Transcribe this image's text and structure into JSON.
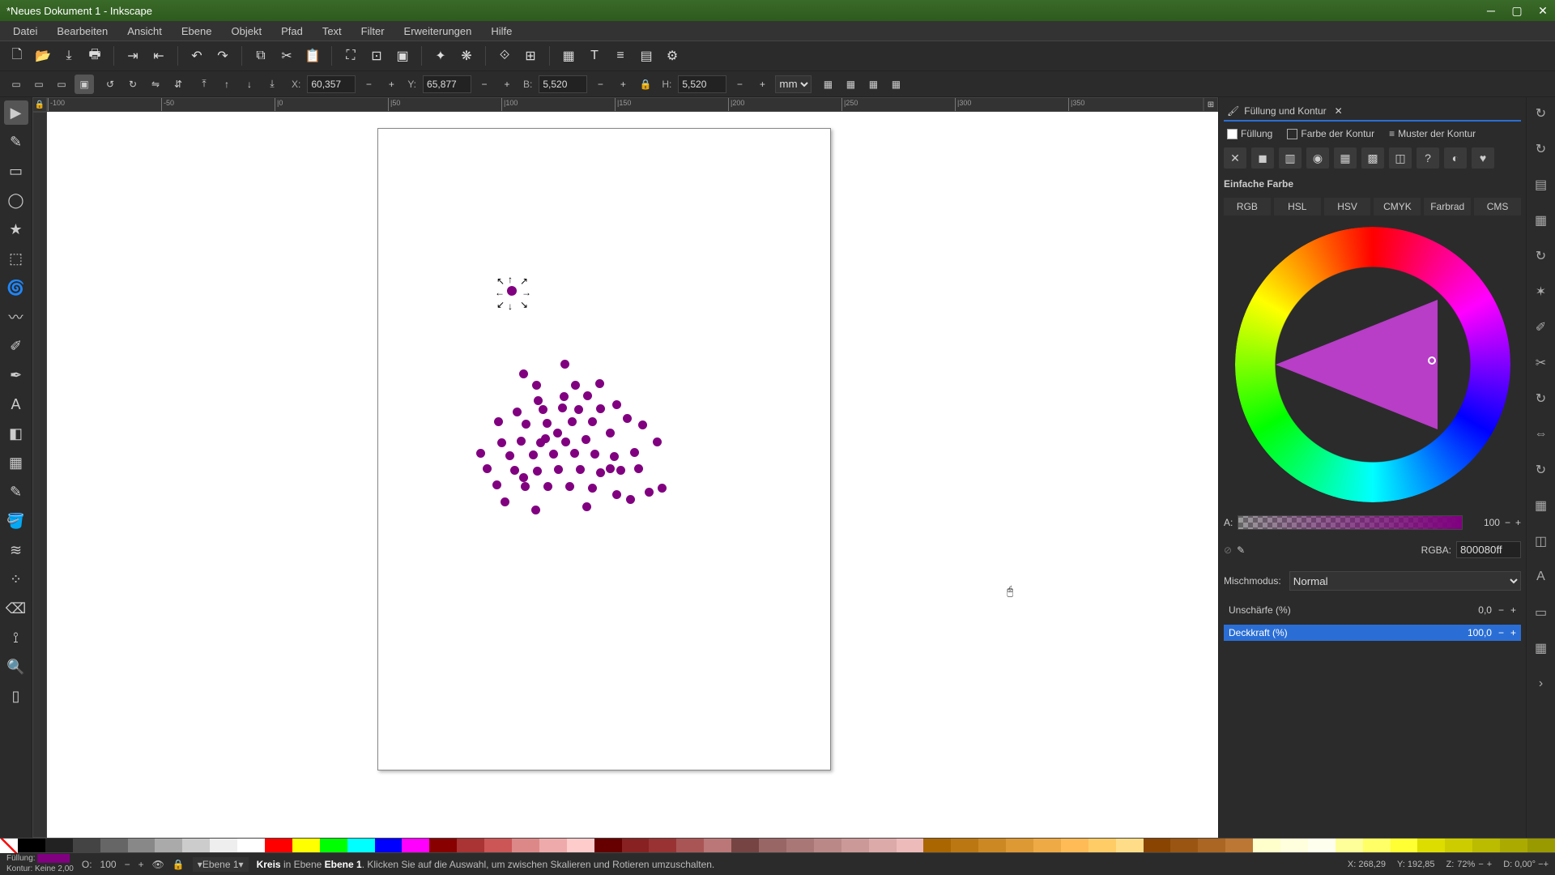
{
  "window": {
    "title": "*Neues Dokument 1 - Inkscape"
  },
  "menu": [
    "Datei",
    "Bearbeiten",
    "Ansicht",
    "Ebene",
    "Objekt",
    "Pfad",
    "Text",
    "Filter",
    "Erweiterungen",
    "Hilfe"
  ],
  "toolcontrols": {
    "x_label": "X:",
    "x_value": "60,357",
    "y_label": "Y:",
    "y_value": "65,877",
    "b_label": "B:",
    "b_value": "5,520",
    "h_label": "H:",
    "h_value": "5,520",
    "unit": "mm"
  },
  "ruler_ticks": [
    "-100",
    "-50",
    "|0",
    "|50",
    "|100",
    "|150",
    "|200",
    "|250",
    "|300",
    "|350"
  ],
  "fillstroke": {
    "title": "Füllung und Kontur",
    "tabs": {
      "fill": "Füllung",
      "stroke_color": "Farbe der Kontur",
      "stroke_style": "Muster der Kontur"
    },
    "section": "Einfache Farbe",
    "modes": [
      "RGB",
      "HSL",
      "HSV",
      "CMYK",
      "Farbrad",
      "CMS"
    ],
    "alpha_label": "A:",
    "alpha_value": "100",
    "rgba_label": "RGBA:",
    "rgba_value": "800080ff",
    "blend_label": "Mischmodus:",
    "blend_value": "Normal",
    "blur_label": "Unschärfe (%)",
    "blur_value": "0,0",
    "opacity_label": "Deckkraft (%)",
    "opacity_value": "100,0"
  },
  "status": {
    "fill_label": "Füllung:",
    "stroke_label": "Kontur:",
    "stroke_value": "Keine",
    "stroke_width": "2,00",
    "o_label": "O:",
    "o_value": "100",
    "layer": "Ebene 1",
    "object": "Kreis",
    "hint_prefix": "in Ebene",
    "hint_layer": "Ebene 1",
    "hint_suffix": ". Klicken Sie auf die Auswahl, um zwischen Skalieren und Rotieren umzuschalten.",
    "cursor_x_label": "X:",
    "cursor_x": "268,29",
    "cursor_y_label": "Y:",
    "cursor_y": "192,85",
    "zoom_label": "Z:",
    "zoom": "72%",
    "d_label": "D:",
    "d_value": "0,00°"
  },
  "palette_colors": [
    "#000",
    "#222",
    "#444",
    "#666",
    "#888",
    "#aaa",
    "#ccc",
    "#eee",
    "#fff",
    "#f00",
    "#ff0",
    "#0f0",
    "#0ff",
    "#00f",
    "#f0f",
    "#800",
    "#a33",
    "#c55",
    "#d88",
    "#eaa",
    "#fcc",
    "#600",
    "#822",
    "#933",
    "#a55",
    "#b77",
    "#744",
    "#966",
    "#a77",
    "#b88",
    "#c99",
    "#daa",
    "#ebb",
    "#a60",
    "#b71",
    "#c82",
    "#d93",
    "#ea4",
    "#fb5",
    "#fc6",
    "#fd8",
    "#840",
    "#951",
    "#a62",
    "#b73",
    "#ffc",
    "#ffd",
    "#ffe",
    "#ff9",
    "#ff6",
    "#ff3",
    "#dd0",
    "#cc0",
    "#bb0",
    "#aa0",
    "#990"
  ],
  "dots": [
    [
      63,
      58
    ],
    [
      114,
      46
    ],
    [
      157,
      70
    ],
    [
      79,
      72
    ],
    [
      127,
      72
    ],
    [
      81,
      91
    ],
    [
      113,
      86
    ],
    [
      142,
      85
    ],
    [
      55,
      105
    ],
    [
      87,
      102
    ],
    [
      111,
      100
    ],
    [
      131,
      102
    ],
    [
      158,
      101
    ],
    [
      178,
      96
    ],
    [
      32,
      117
    ],
    [
      66,
      120
    ],
    [
      92,
      119
    ],
    [
      123,
      117
    ],
    [
      148,
      117
    ],
    [
      105,
      131
    ],
    [
      36,
      143
    ],
    [
      60,
      141
    ],
    [
      84,
      143
    ],
    [
      115,
      142
    ],
    [
      140,
      139
    ],
    [
      170,
      131
    ],
    [
      191,
      113
    ],
    [
      210,
      121
    ],
    [
      10,
      156
    ],
    [
      46,
      159
    ],
    [
      75,
      158
    ],
    [
      100,
      157
    ],
    [
      126,
      156
    ],
    [
      151,
      157
    ],
    [
      175,
      160
    ],
    [
      200,
      155
    ],
    [
      228,
      142
    ],
    [
      18,
      175
    ],
    [
      52,
      177
    ],
    [
      80,
      178
    ],
    [
      106,
      176
    ],
    [
      133,
      176
    ],
    [
      158,
      180
    ],
    [
      183,
      177
    ],
    [
      30,
      195
    ],
    [
      65,
      197
    ],
    [
      93,
      197
    ],
    [
      120,
      197
    ],
    [
      148,
      199
    ],
    [
      178,
      207
    ],
    [
      218,
      204
    ],
    [
      234,
      199
    ],
    [
      40,
      216
    ],
    [
      78,
      226
    ],
    [
      141,
      222
    ],
    [
      195,
      213
    ],
    [
      63,
      186
    ],
    [
      90,
      138
    ],
    [
      170,
      175
    ],
    [
      205,
      175
    ]
  ]
}
